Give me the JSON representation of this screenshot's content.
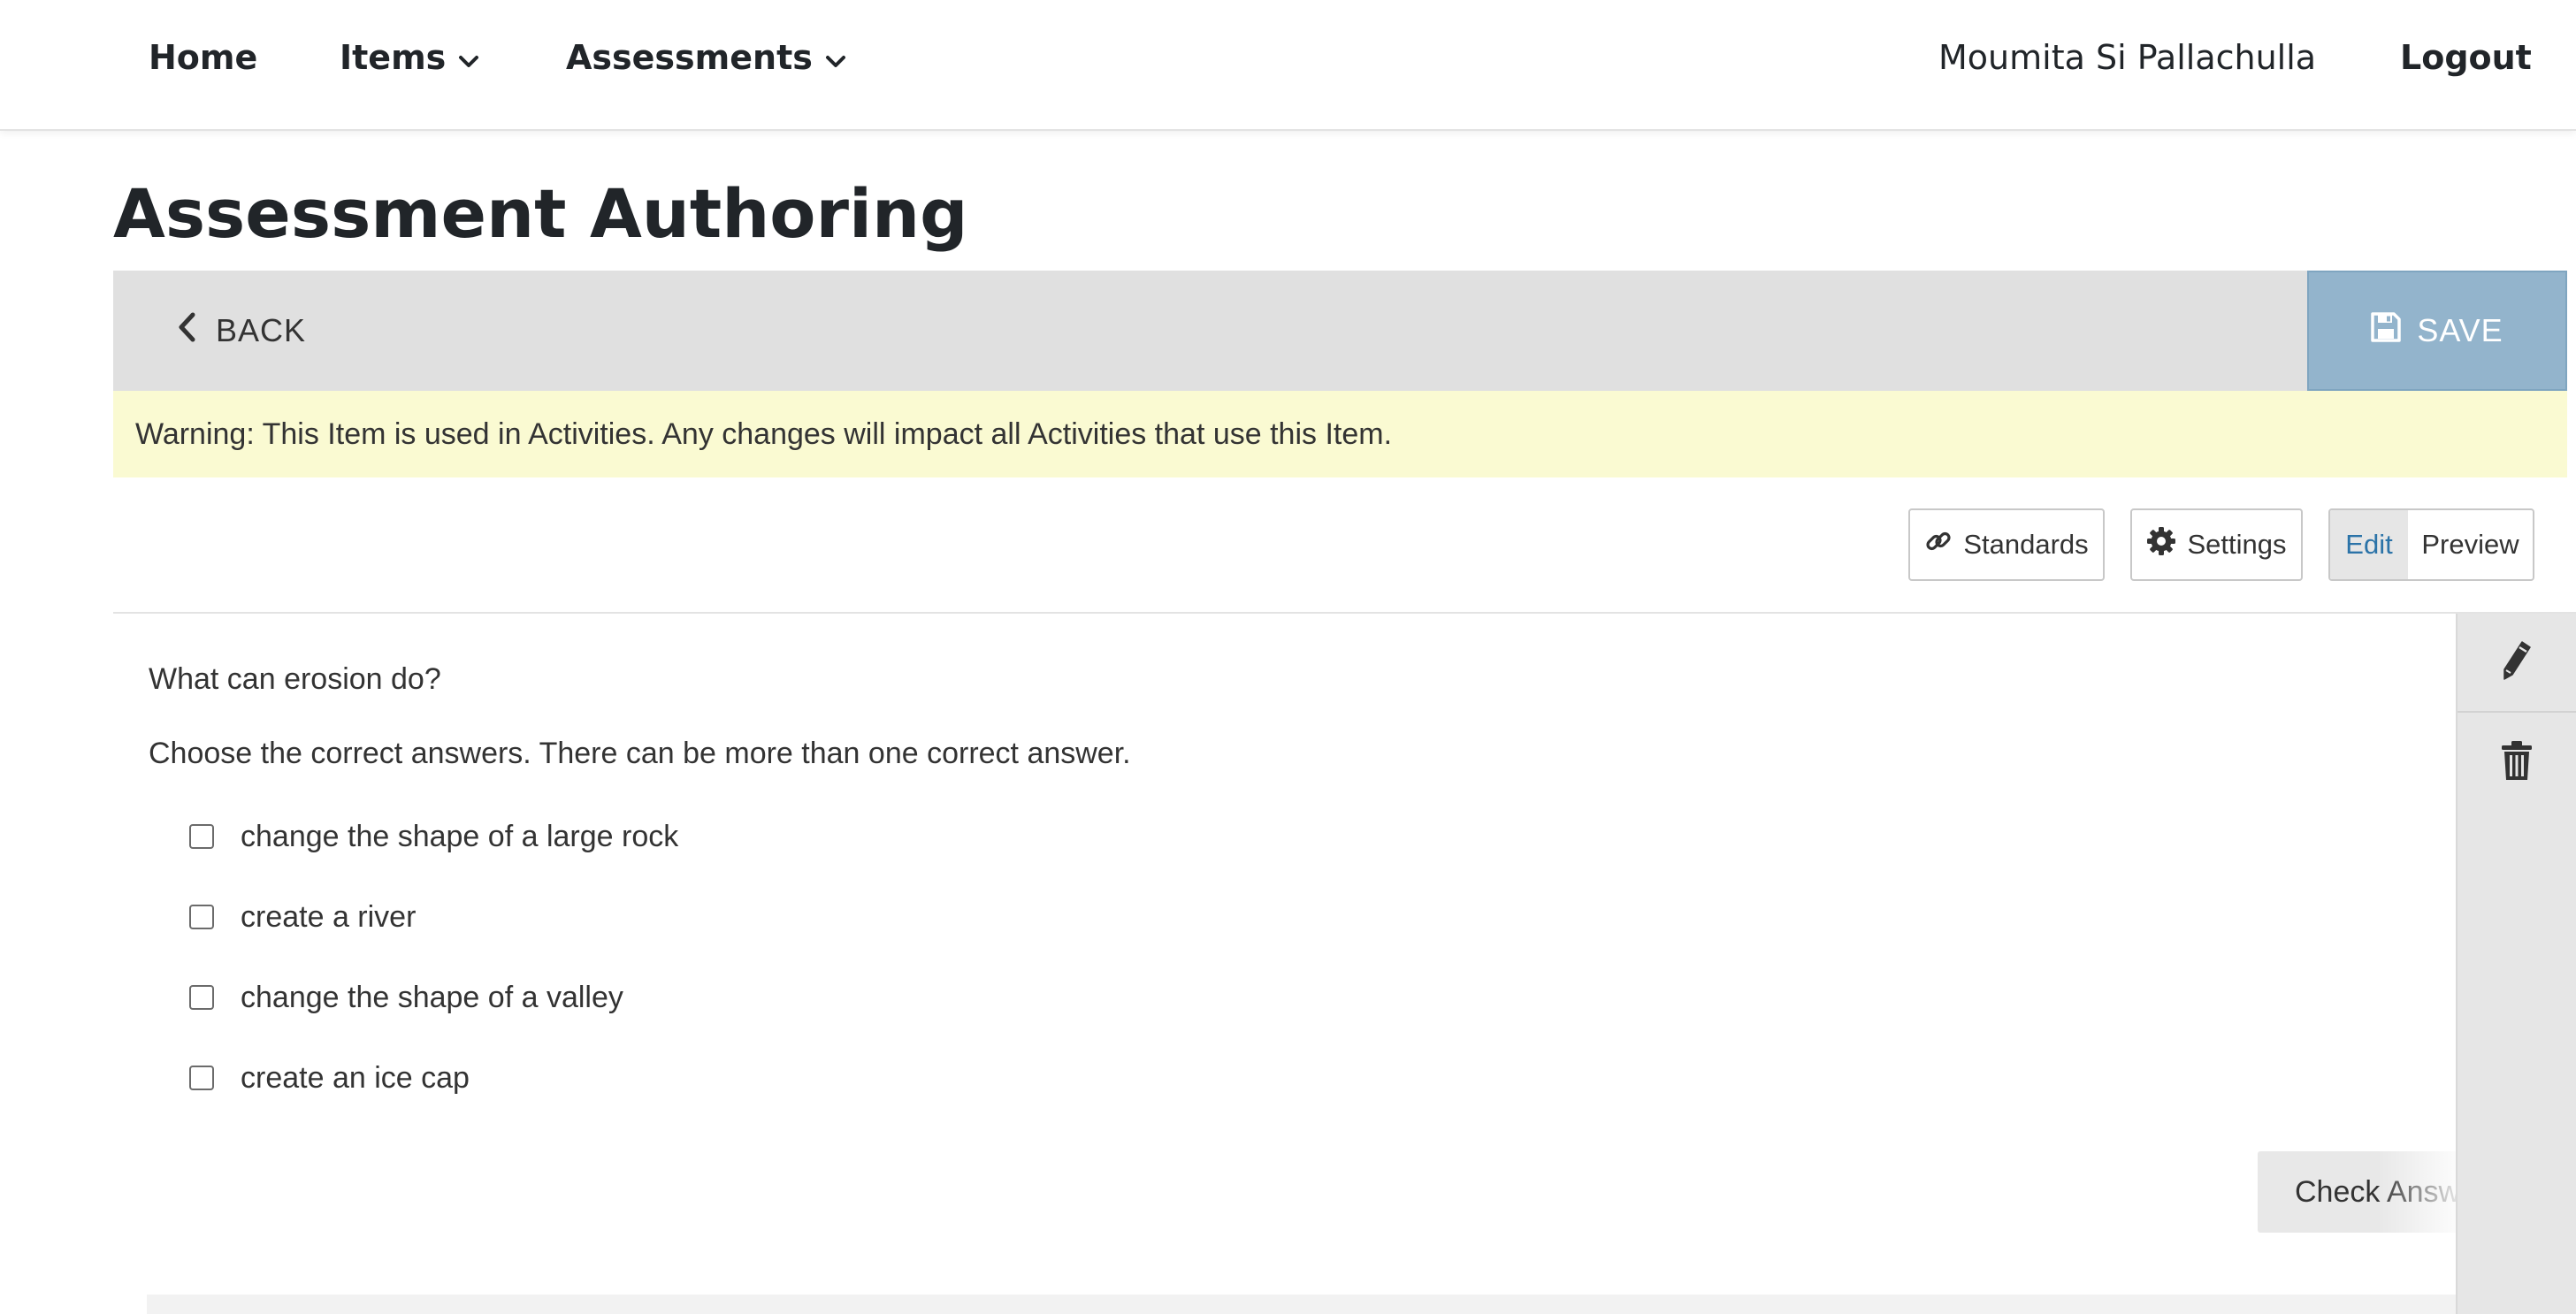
{
  "nav": {
    "home": "Home",
    "items": "Items",
    "assessments": "Assessments",
    "user": "Moumita Si Pallachulla",
    "logout": "Logout"
  },
  "page": {
    "title": "Assessment Authoring"
  },
  "toolbar": {
    "back_label": "BACK",
    "save_label": "SAVE",
    "back_icon": "chevron-left-icon",
    "save_icon": "floppy-disk-icon"
  },
  "warning": {
    "text": "Warning: This Item is used in Activities. Any changes will impact all Activities that use this Item."
  },
  "actions": {
    "standards_label": "Standards",
    "settings_label": "Settings",
    "edit_label": "Edit",
    "preview_label": "Preview",
    "active_mode": "Edit"
  },
  "question": {
    "stem": "What can erosion do?",
    "instruction": "Choose the correct answers. There can be more than one correct answer.",
    "options": [
      {
        "label": "change the shape of a large rock",
        "checked": false
      },
      {
        "label": "create a river",
        "checked": false
      },
      {
        "label": "change the shape of a valley",
        "checked": false
      },
      {
        "label": "create an ice cap",
        "checked": false
      }
    ],
    "check_answer_label": "Check Answer"
  },
  "side_panel": {
    "icons": [
      "pencil-icon",
      "trash-icon"
    ]
  },
  "colors": {
    "save_button": "#93b4cc",
    "warning_bg": "#fafad2",
    "toolbar_bg": "#e0e0e0",
    "edit_active_text": "#2b73a8",
    "text_primary": "#212529"
  }
}
